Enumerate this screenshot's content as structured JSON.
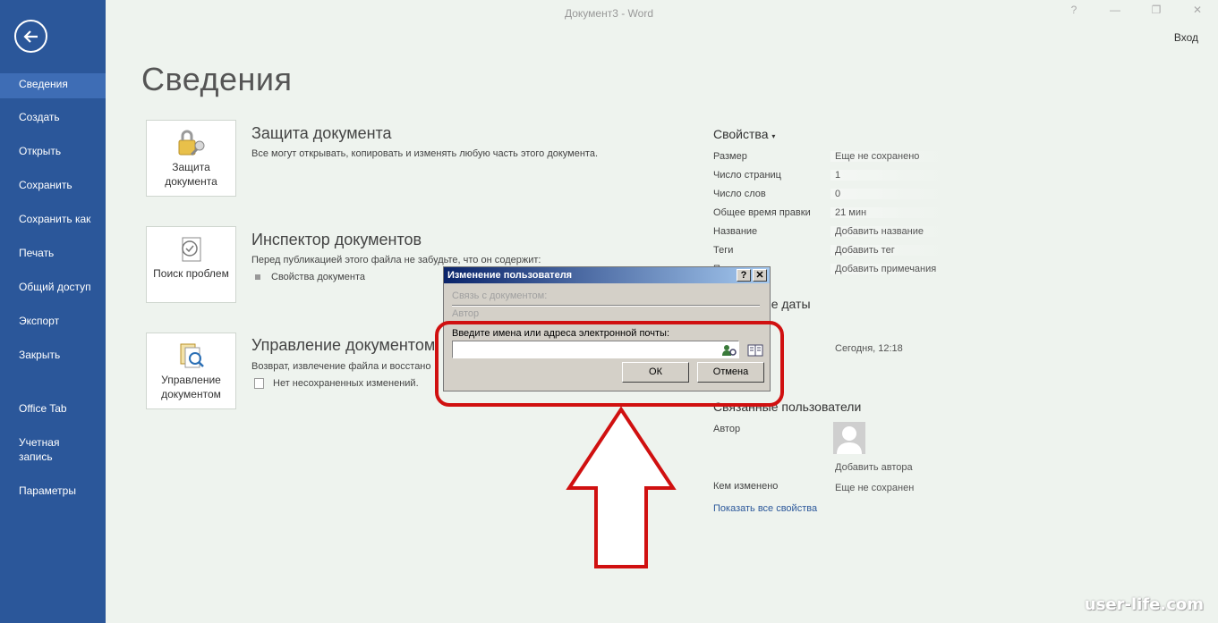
{
  "window": {
    "title": "Документ3 - Word",
    "help": "?",
    "minimize": "—",
    "restore": "❐",
    "close": "✕",
    "login": "Вход"
  },
  "sidebar": {
    "items": [
      {
        "label": "Сведения",
        "active": true
      },
      {
        "label": "Создать"
      },
      {
        "label": "Открыть"
      },
      {
        "label": "Сохранить"
      },
      {
        "label": "Сохранить как"
      },
      {
        "label": "Печать"
      },
      {
        "label": "Общий доступ"
      },
      {
        "label": "Экспорт"
      },
      {
        "label": "Закрыть"
      },
      {
        "label": "Office Tab"
      },
      {
        "label": "Учетная запись"
      },
      {
        "label": "Параметры"
      }
    ]
  },
  "page": {
    "title": "Сведения"
  },
  "sections": [
    {
      "button_label": "Защита документа",
      "icon": "lock-key-icon",
      "title": "Защита документа",
      "description": "Все могут открывать, копировать и изменять любую часть этого документа."
    },
    {
      "button_label": "Поиск проблем",
      "icon": "inspect-document-icon",
      "title": "Инспектор документов",
      "description": "Перед публикацией этого файла не забудьте, что он содержит:",
      "bullet": "Свойства документа"
    },
    {
      "button_label": "Управление документом",
      "icon": "manage-document-icon",
      "title": "Управление документом",
      "description": "Возврат, извлечение файла и восстано",
      "bullet": "Нет несохраненных изменений."
    }
  ],
  "properties": {
    "title": "Свойства",
    "rows": [
      {
        "label": "Размер",
        "value": "Еще не сохранено"
      },
      {
        "label": "Число страниц",
        "value": "1"
      },
      {
        "label": "Число слов",
        "value": "0"
      },
      {
        "label": "Общее время правки",
        "value": "21 мин"
      },
      {
        "label": "Название",
        "value": "Добавить название"
      },
      {
        "label": "Теги",
        "value": "Добавить тег"
      },
      {
        "label": "Примечания",
        "value": "Добавить примечания"
      }
    ],
    "dates_header": "Связанные даты",
    "created_value": "Сегодня, 12:18",
    "people_header": "Связанные пользователи",
    "author_label": "Автор",
    "add_author": "Добавить автора",
    "modified_by_label": "Кем изменено",
    "modified_by_value": "Еще не сохранен",
    "show_all": "Показать все свойства"
  },
  "dialog": {
    "title": "Изменение пользователя",
    "help": "?",
    "close": "✕",
    "group_label": "Связь с документом:",
    "author_field": "Автор",
    "prompt": "Введите имена или адреса электронной почты:",
    "input_value": "",
    "ok": "ОК",
    "cancel": "Отмена"
  },
  "watermark": "user-life.com",
  "colors": {
    "sidebar": "#2b579a",
    "background": "#eef3ee",
    "highlight": "#d01010"
  }
}
